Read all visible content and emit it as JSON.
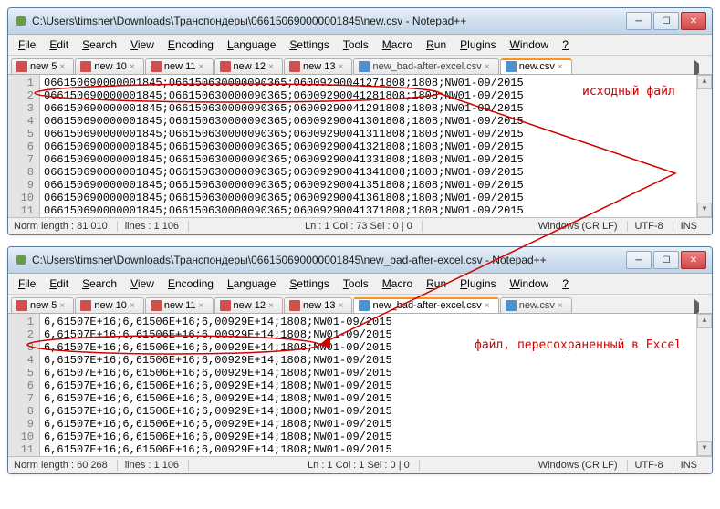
{
  "windows": [
    {
      "title": "C:\\Users\\timsher\\Downloads\\Транспондеры\\066150690000001845\\new.csv - Notepad++",
      "menus": [
        "File",
        "Edit",
        "Search",
        "View",
        "Encoding",
        "Language",
        "Settings",
        "Tools",
        "Macro",
        "Run",
        "Plugins",
        "Window",
        "?"
      ],
      "tabs": [
        {
          "label": "new 5",
          "modified": true,
          "active": false
        },
        {
          "label": "new 10",
          "modified": true,
          "active": false
        },
        {
          "label": "new 11",
          "modified": true,
          "active": false
        },
        {
          "label": "new 12",
          "modified": true,
          "active": false
        },
        {
          "label": "new 13",
          "modified": true,
          "active": false
        },
        {
          "label": "new_bad-after-excel.csv",
          "modified": false,
          "active": false
        },
        {
          "label": "new.csv",
          "modified": false,
          "active": true
        }
      ],
      "lines": [
        "066150690000001845;066150630000090365;06009290041271808;1808;NW01-09/2015",
        "066150690000001845;066150630000090365;06009290041281808;1808;NW01-09/2015",
        "066150690000001845;066150630000090365;06009290041291808;1808;NW01-09/2015",
        "066150690000001845;066150630000090365;06009290041301808;1808;NW01-09/2015",
        "066150690000001845;066150630000090365;06009290041311808;1808;NW01-09/2015",
        "066150690000001845;066150630000090365;06009290041321808;1808;NW01-09/2015",
        "066150690000001845;066150630000090365;06009290041331808;1808;NW01-09/2015",
        "066150690000001845;066150630000090365;06009290041341808;1808;NW01-09/2015",
        "066150690000001845;066150630000090365;06009290041351808;1808;NW01-09/2015",
        "066150690000001845;066150630000090365;06009290041361808;1808;NW01-09/2015",
        "066150690000001845;066150630000090365;06009290041371808;1808;NW01-09/2015"
      ],
      "status": {
        "length_label": "Norm  length : 81 010",
        "lines_label": "lines : 1 106",
        "pos": "Ln : 1    Col : 73    Sel : 0 | 0",
        "eol": "Windows (CR LF)",
        "enc": "UTF-8",
        "mode": "INS"
      },
      "annotation": "исходный файл"
    },
    {
      "title": "C:\\Users\\timsher\\Downloads\\Транспондеры\\066150690000001845\\new_bad-after-excel.csv - Notepad++",
      "menus": [
        "File",
        "Edit",
        "Search",
        "View",
        "Encoding",
        "Language",
        "Settings",
        "Tools",
        "Macro",
        "Run",
        "Plugins",
        "Window",
        "?"
      ],
      "tabs": [
        {
          "label": "new 5",
          "modified": true,
          "active": false
        },
        {
          "label": "new 10",
          "modified": true,
          "active": false
        },
        {
          "label": "new 11",
          "modified": true,
          "active": false
        },
        {
          "label": "new 12",
          "modified": true,
          "active": false
        },
        {
          "label": "new 13",
          "modified": true,
          "active": false
        },
        {
          "label": "new_bad-after-excel.csv",
          "modified": false,
          "active": true
        },
        {
          "label": "new.csv",
          "modified": false,
          "active": false
        }
      ],
      "lines": [
        "6,61507E+16;6,61506E+16;6,00929E+14;1808;NW01-09/2015",
        "6,61507E+16;6,61506E+16;6,00929E+14;1808;NW01-09/2015",
        "6,61507E+16;6,61506E+16;6,00929E+14;1808;NW01-09/2015",
        "6,61507E+16;6,61506E+16;6,00929E+14;1808;NW01-09/2015",
        "6,61507E+16;6,61506E+16;6,00929E+14;1808;NW01-09/2015",
        "6,61507E+16;6,61506E+16;6,00929E+14;1808;NW01-09/2015",
        "6,61507E+16;6,61506E+16;6,00929E+14;1808;NW01-09/2015",
        "6,61507E+16;6,61506E+16;6,00929E+14;1808;NW01-09/2015",
        "6,61507E+16;6,61506E+16;6,00929E+14;1808;NW01-09/2015",
        "6,61507E+16;6,61506E+16;6,00929E+14;1808;NW01-09/2015",
        "6,61507E+16;6,61506E+16;6,00929E+14;1808;NW01-09/2015"
      ],
      "status": {
        "length_label": "Norm  length : 60 268",
        "lines_label": "lines : 1 106",
        "pos": "Ln : 1    Col : 1    Sel : 0 | 0",
        "eol": "Windows (CR LF)",
        "enc": "UTF-8",
        "mode": "INS"
      },
      "annotation": "файл, пересохраненный в Excel"
    }
  ]
}
